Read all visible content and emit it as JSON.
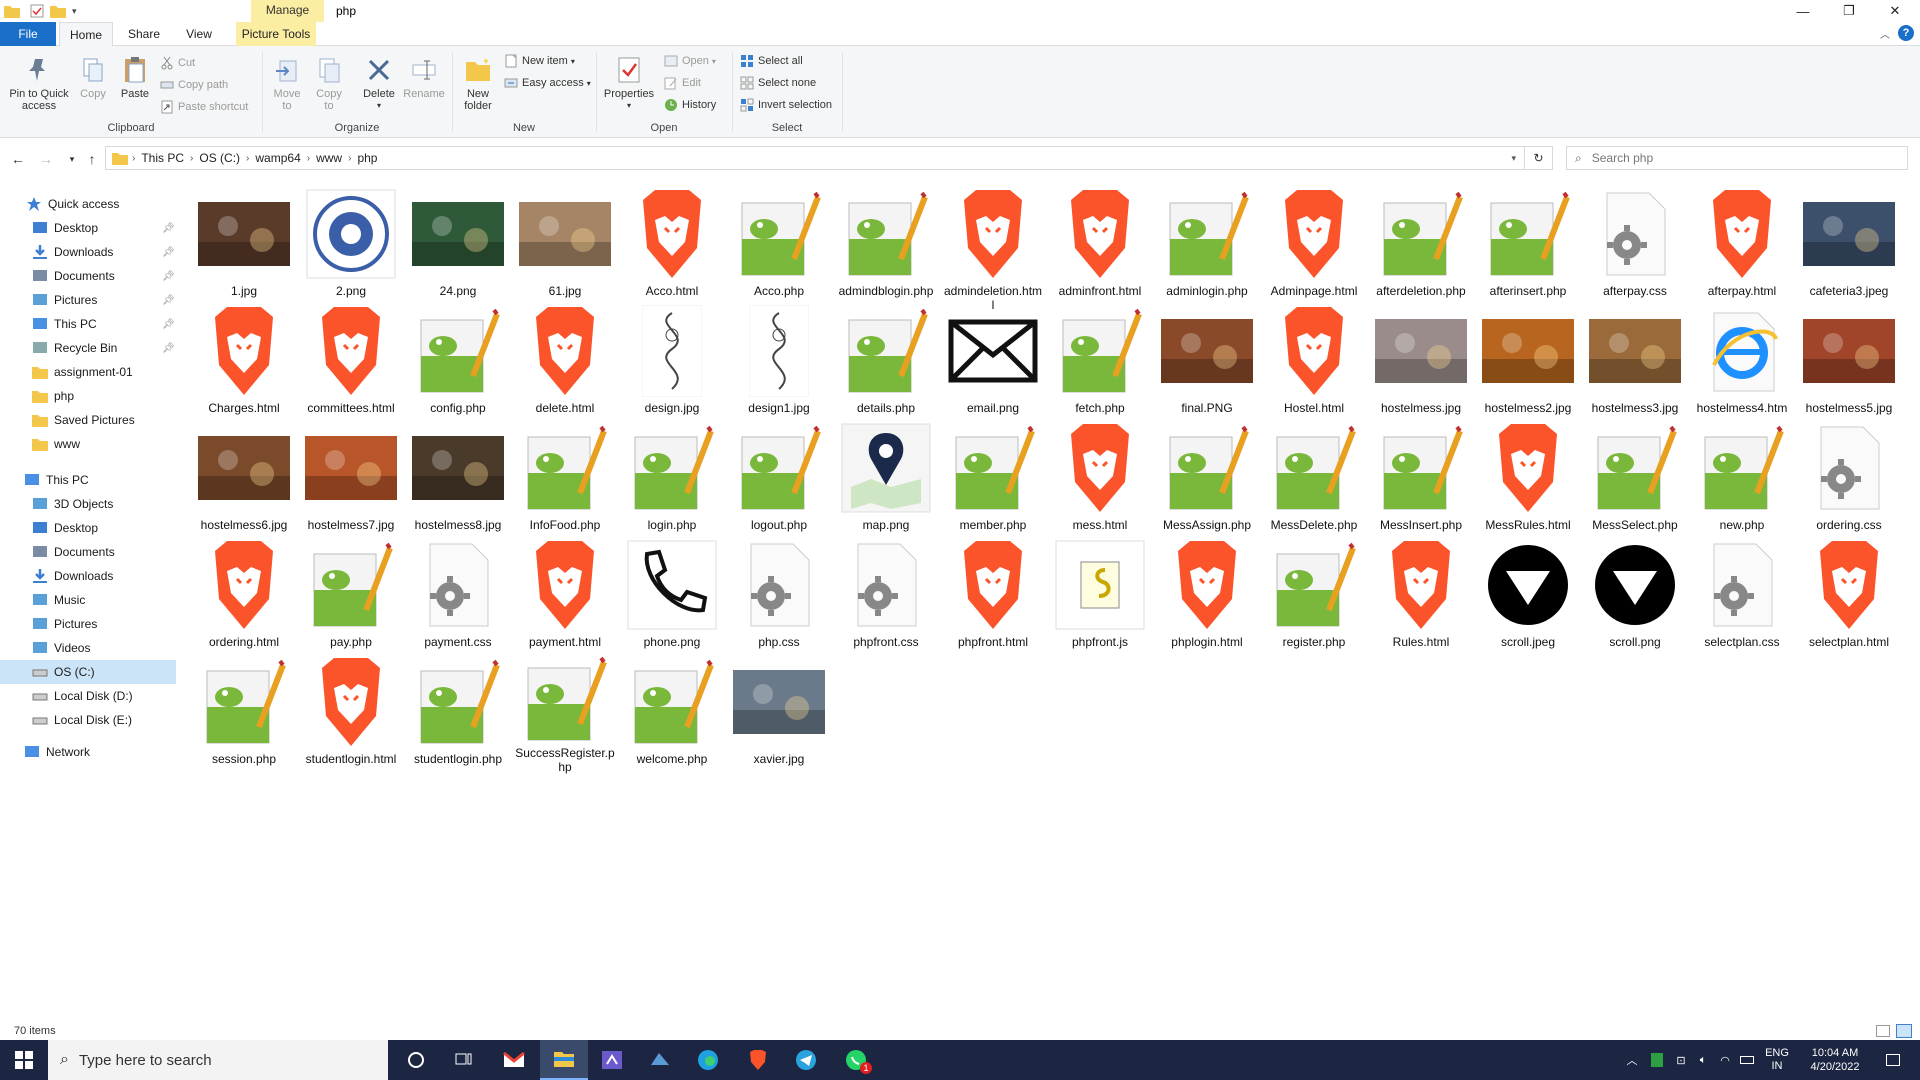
{
  "titlebar": {
    "context_tab": "Manage",
    "window_title": "php",
    "minimize": "—",
    "maximize": "❐",
    "close": "✕"
  },
  "tabs": {
    "file": "File",
    "home": "Home",
    "share": "Share",
    "view": "View",
    "picture_tools": "Picture Tools"
  },
  "ribbon": {
    "clipboard": {
      "pin": "Pin to Quick access",
      "copy": "Copy",
      "paste": "Paste",
      "cut": "Cut",
      "copy_path": "Copy path",
      "paste_shortcut": "Paste shortcut",
      "label": "Clipboard"
    },
    "organize": {
      "move_to": "Move to",
      "copy_to": "Copy to",
      "delete": "Delete",
      "rename": "Rename",
      "label": "Organize"
    },
    "new": {
      "new_folder": "New folder",
      "new_item": "New item",
      "easy_access": "Easy access",
      "label": "New"
    },
    "open": {
      "properties": "Properties",
      "open": "Open",
      "edit": "Edit",
      "history": "History",
      "label": "Open"
    },
    "select": {
      "select_all": "Select all",
      "select_none": "Select none",
      "invert": "Invert selection",
      "label": "Select"
    }
  },
  "address": {
    "crumbs": [
      "This PC",
      "OS (C:)",
      "wamp64",
      "www",
      "php"
    ],
    "search_placeholder": "Search php"
  },
  "nav": {
    "quick_access": "Quick access",
    "qa_items": [
      "Desktop",
      "Downloads",
      "Documents",
      "Pictures",
      "This PC",
      "Recycle Bin",
      "assignment-01",
      "php",
      "Saved Pictures",
      "www"
    ],
    "this_pc": "This PC",
    "pc_items": [
      "3D Objects",
      "Desktop",
      "Documents",
      "Downloads",
      "Music",
      "Pictures",
      "Videos",
      "OS (C:)",
      "Local Disk (D:)",
      "Local Disk (E:)"
    ],
    "network": "Network"
  },
  "files": [
    {
      "name": "1.jpg",
      "type": "photo",
      "color": "#5a3b2a"
    },
    {
      "name": "2.png",
      "type": "logo",
      "color": "#3a5fa8"
    },
    {
      "name": "24.png",
      "type": "photo",
      "color": "#2f5a3a"
    },
    {
      "name": "61.jpg",
      "type": "photo",
      "color": "#a58566"
    },
    {
      "name": "Acco.html",
      "type": "brave",
      "color": "#fb542b"
    },
    {
      "name": "Acco.php",
      "type": "npp",
      "color": "#7ab83b"
    },
    {
      "name": "admindblogin.php",
      "type": "npp",
      "color": "#7ab83b"
    },
    {
      "name": "admindeletion.html",
      "type": "brave",
      "color": "#fb542b"
    },
    {
      "name": "adminfront.html",
      "type": "brave",
      "color": "#fb542b"
    },
    {
      "name": "adminlogin.php",
      "type": "npp",
      "color": "#7ab83b"
    },
    {
      "name": "Adminpage.html",
      "type": "brave",
      "color": "#fb542b"
    },
    {
      "name": "afterdeletion.php",
      "type": "npp",
      "color": "#7ab83b"
    },
    {
      "name": "afterinsert.php",
      "type": "npp",
      "color": "#7ab83b"
    },
    {
      "name": "afterpay.css",
      "type": "gear",
      "color": "#888888"
    },
    {
      "name": "afterpay.html",
      "type": "brave",
      "color": "#fb542b"
    },
    {
      "name": "cafeteria3.jpeg",
      "type": "photo",
      "color": "#3c4f6b"
    },
    {
      "name": "Charges.html",
      "type": "brave",
      "color": "#fb542b"
    },
    {
      "name": "committees.html",
      "type": "brave",
      "color": "#fb542b"
    },
    {
      "name": "config.php",
      "type": "npp",
      "color": "#7ab83b"
    },
    {
      "name": "delete.html",
      "type": "brave",
      "color": "#fb542b"
    },
    {
      "name": "design.jpg",
      "type": "sketch",
      "color": "#444444"
    },
    {
      "name": "design1.jpg",
      "type": "sketch",
      "color": "#444444"
    },
    {
      "name": "details.php",
      "type": "npp",
      "color": "#7ab83b"
    },
    {
      "name": "email.png",
      "type": "mail",
      "color": "#111111"
    },
    {
      "name": "fetch.php",
      "type": "npp",
      "color": "#7ab83b"
    },
    {
      "name": "final.PNG",
      "type": "photo",
      "color": "#8a4a2a"
    },
    {
      "name": "Hostel.html",
      "type": "brave",
      "color": "#fb542b"
    },
    {
      "name": "hostelmess.jpg",
      "type": "photo",
      "color": "#9a8c8a"
    },
    {
      "name": "hostelmess2.jpg",
      "type": "photo",
      "color": "#b8661f"
    },
    {
      "name": "hostelmess3.jpg",
      "type": "photo",
      "color": "#9a6a3a"
    },
    {
      "name": "hostelmess4.htm",
      "type": "ie",
      "color": "#1e90ff"
    },
    {
      "name": "hostelmess5.jpg",
      "type": "photo",
      "color": "#a0442a"
    },
    {
      "name": "hostelmess6.jpg",
      "type": "photo",
      "color": "#7a4a2a"
    },
    {
      "name": "hostelmess7.jpg",
      "type": "photo",
      "color": "#b8562a"
    },
    {
      "name": "hostelmess8.jpg",
      "type": "photo",
      "color": "#4a3a2a"
    },
    {
      "name": "InfoFood.php",
      "type": "npp",
      "color": "#7ab83b"
    },
    {
      "name": "login.php",
      "type": "npp",
      "color": "#7ab83b"
    },
    {
      "name": "logout.php",
      "type": "npp",
      "color": "#7ab83b"
    },
    {
      "name": "map.png",
      "type": "map",
      "color": "#1b2a4a"
    },
    {
      "name": "member.php",
      "type": "npp",
      "color": "#7ab83b"
    },
    {
      "name": "mess.html",
      "type": "brave",
      "color": "#fb542b"
    },
    {
      "name": "MessAssign.php",
      "type": "npp",
      "color": "#7ab83b"
    },
    {
      "name": "MessDelete.php",
      "type": "npp",
      "color": "#7ab83b"
    },
    {
      "name": "MessInsert.php",
      "type": "npp",
      "color": "#7ab83b"
    },
    {
      "name": "MessRules.html",
      "type": "brave",
      "color": "#fb542b"
    },
    {
      "name": "MessSelect.php",
      "type": "npp",
      "color": "#7ab83b"
    },
    {
      "name": "new.php",
      "type": "npp",
      "color": "#7ab83b"
    },
    {
      "name": "ordering.css",
      "type": "gear",
      "color": "#888888"
    },
    {
      "name": "ordering.html",
      "type": "brave",
      "color": "#fb542b"
    },
    {
      "name": "pay.php",
      "type": "npp",
      "color": "#7ab83b"
    },
    {
      "name": "payment.css",
      "type": "gear",
      "color": "#888888"
    },
    {
      "name": "payment.html",
      "type": "brave",
      "color": "#fb542b"
    },
    {
      "name": "phone.png",
      "type": "phone",
      "color": "#111111"
    },
    {
      "name": "php.css",
      "type": "gear",
      "color": "#888888"
    },
    {
      "name": "phpfront.css",
      "type": "gear",
      "color": "#888888"
    },
    {
      "name": "phpfront.html",
      "type": "brave",
      "color": "#fb542b"
    },
    {
      "name": "phpfront.js",
      "type": "js",
      "color": "#c8a800"
    },
    {
      "name": "phplogin.html",
      "type": "brave",
      "color": "#fb542b"
    },
    {
      "name": "register.php",
      "type": "npp",
      "color": "#7ab83b"
    },
    {
      "name": "Rules.html",
      "type": "brave",
      "color": "#fb542b"
    },
    {
      "name": "scroll.jpeg",
      "type": "scroll",
      "color": "#000000"
    },
    {
      "name": "scroll.png",
      "type": "scroll",
      "color": "#000000"
    },
    {
      "name": "selectplan.css",
      "type": "gear",
      "color": "#888888"
    },
    {
      "name": "selectplan.html",
      "type": "brave",
      "color": "#fb542b"
    },
    {
      "name": "session.php",
      "type": "npp",
      "color": "#7ab83b"
    },
    {
      "name": "studentlogin.html",
      "type": "brave",
      "color": "#fb542b"
    },
    {
      "name": "studentlogin.php",
      "type": "npp",
      "color": "#7ab83b"
    },
    {
      "name": "SuccessRegister.php",
      "type": "npp",
      "color": "#7ab83b"
    },
    {
      "name": "welcome.php",
      "type": "npp",
      "color": "#7ab83b"
    },
    {
      "name": "xavier.jpg",
      "type": "photo",
      "color": "#6a7a8a"
    }
  ],
  "status": {
    "count": "70 items"
  },
  "taskbar": {
    "search_placeholder": "Type here to search",
    "lang_top": "ENG",
    "lang_bottom": "IN",
    "time": "10:04 AM",
    "date": "4/20/2022",
    "whatsapp_badge": "1"
  },
  "colors": {
    "file_tab": "#1a6fc8",
    "context_tab": "#fbeea3",
    "taskbar": "#1c2541",
    "selection": "#cce4f7"
  }
}
